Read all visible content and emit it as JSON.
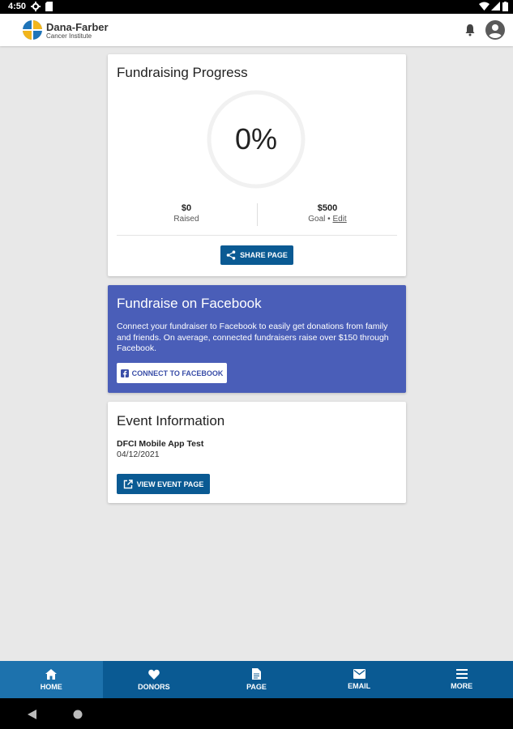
{
  "status_bar": {
    "time": "4:50"
  },
  "header": {
    "logo_line1": "Dana-Farber",
    "logo_line2": "Cancer Institute",
    "bell_icon": "bell-icon",
    "account_icon": "account-circle-icon"
  },
  "progress_card": {
    "title": "Fundraising Progress",
    "percent_text": "0%",
    "progress_fraction": 0,
    "raised_value": "$0",
    "raised_label": "Raised",
    "goal_value": "$500",
    "goal_label": "Goal •",
    "edit_label": "Edit",
    "share_button": "SHARE PAGE"
  },
  "facebook_card": {
    "title": "Fundraise on Facebook",
    "body": "Connect your fundraiser to Facebook to easily get donations from family and friends. On average, connected fundraisers raise over $150 through Facebook.",
    "connect_button": "CONNECT TO FACEBOOK"
  },
  "event_card": {
    "title": "Event Information",
    "event_name": "DFCI Mobile App Test",
    "event_date": "04/12/2021",
    "view_button": "VIEW EVENT PAGE"
  },
  "bottom_nav": {
    "items": [
      {
        "label": "HOME",
        "icon": "home-icon"
      },
      {
        "label": "DONORS",
        "icon": "heart-icon"
      },
      {
        "label": "PAGE",
        "icon": "page-icon"
      },
      {
        "label": "EMAIL",
        "icon": "mail-icon"
      },
      {
        "label": "MORE",
        "icon": "menu-icon"
      }
    ]
  },
  "colors": {
    "primary": "#0a5a93",
    "facebook_card": "#4a5eb8",
    "background": "#e8e8e8"
  }
}
